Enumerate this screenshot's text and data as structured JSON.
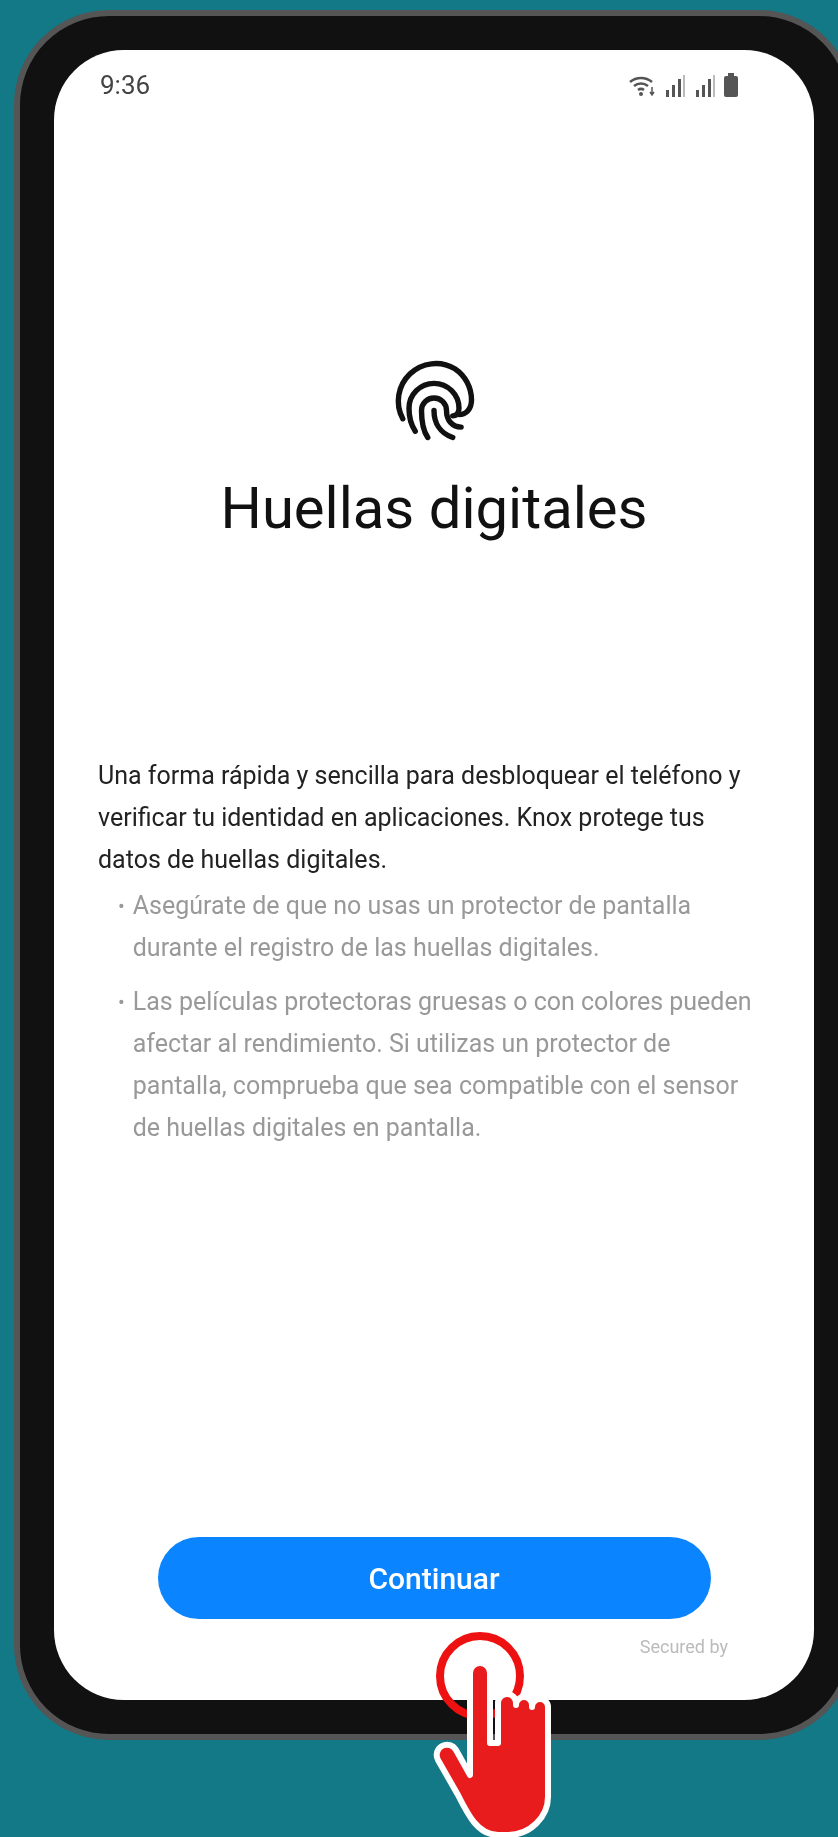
{
  "status_bar": {
    "time": "9:36"
  },
  "title": "Huellas digitales",
  "description": "Una forma rápida y sencilla para desbloquear el teléfono y verificar tu identidad en aplicaciones. Knox protege tus datos de huellas digitales.",
  "bullets": [
    "Asegúrate de que no usas un protector de pantalla durante el registro de las huellas digitales.",
    "Las películas protectoras gruesas o con colores pueden afectar al rendimiento. Si utilizas un protector de pantalla, comprueba que sea compatible con el sensor de huellas digitales en pantalla."
  ],
  "bullet_mark": "•",
  "button": {
    "label": "Continuar"
  },
  "footer": "Secured by"
}
